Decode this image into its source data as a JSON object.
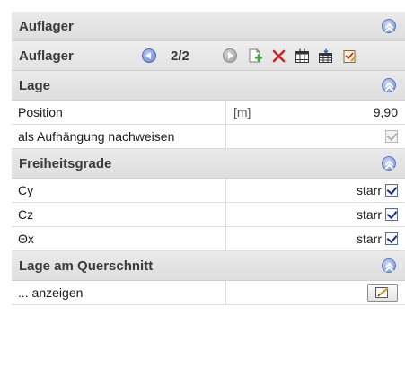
{
  "sections": {
    "auflager": "Auflager",
    "lage": "Lage",
    "freiheitsgrade": "Freiheitsgrade",
    "lage_querschnitt": "Lage am Querschnitt"
  },
  "toolbar": {
    "label": "Auflager",
    "counter": "2/2",
    "icons": [
      "nav-prev",
      "nav-next",
      "add-document",
      "delete-x",
      "table",
      "table-import",
      "edit-check"
    ]
  },
  "lage": {
    "position_label": "Position",
    "position_unit": "[m]",
    "position_value": "9,90",
    "aufhaengung_label": "als Aufhängung nachweisen",
    "aufhaengung_checked": true
  },
  "freiheitsgrade": {
    "rows": [
      {
        "label": "Cy",
        "value": "starr",
        "checked": true
      },
      {
        "label": "Cz",
        "value": "starr",
        "checked": true
      },
      {
        "label": "Θx",
        "value": "starr",
        "checked": true
      }
    ]
  },
  "lage_querschnitt": {
    "anzeigen_label": "... anzeigen"
  },
  "colors": {
    "section_bg": "#e3e3e3",
    "accent_blue": "#5f83cf",
    "delete_red": "#d62020",
    "add_green": "#3aa83a"
  }
}
